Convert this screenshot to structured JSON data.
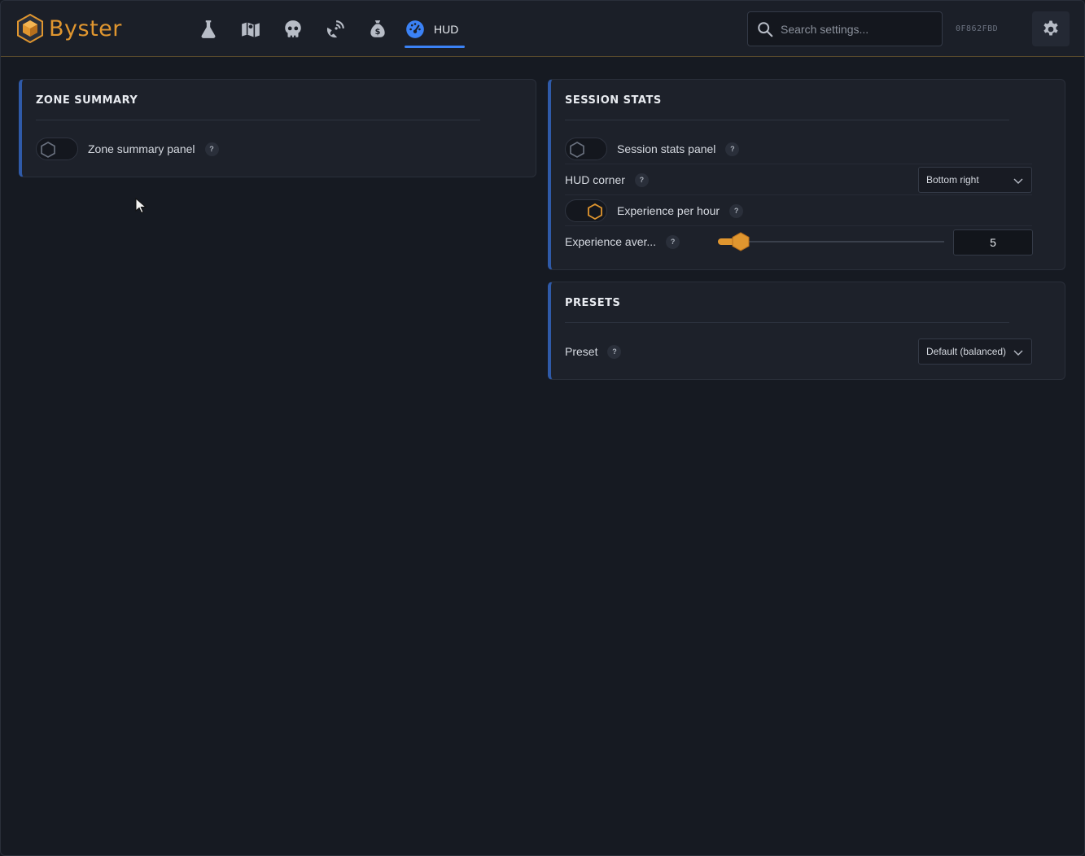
{
  "app": {
    "name": "Byster",
    "hwid": "0F862FBD"
  },
  "colors": {
    "accent": "#e0962f",
    "active_tab": "#3b82f6",
    "panel_border": "#2f5aa8"
  },
  "nav": {
    "tabs": [
      {
        "icon": "flask-icon"
      },
      {
        "icon": "map-icon"
      },
      {
        "icon": "skull-icon"
      },
      {
        "icon": "radar-icon"
      },
      {
        "icon": "money-bag-icon"
      },
      {
        "icon": "gauge-icon",
        "label": "HUD",
        "active": true
      }
    ]
  },
  "search": {
    "placeholder": "Search settings..."
  },
  "zone_summary": {
    "title": "ZONE SUMMARY",
    "panel_toggle": {
      "label": "Zone summary panel",
      "on": false
    }
  },
  "session_stats": {
    "title": "SESSION STATS",
    "panel_toggle": {
      "label": "Session stats panel",
      "on": false
    },
    "hud_corner": {
      "label": "HUD corner",
      "value": "Bottom right"
    },
    "xp_per_hour": {
      "label": "Experience per hour",
      "on": true
    },
    "xp_average": {
      "label": "Experience aver...",
      "value": "5"
    }
  },
  "presets": {
    "title": "PRESETS",
    "preset": {
      "label": "Preset",
      "value": "Default (balanced)"
    }
  },
  "help_glyph": "?"
}
